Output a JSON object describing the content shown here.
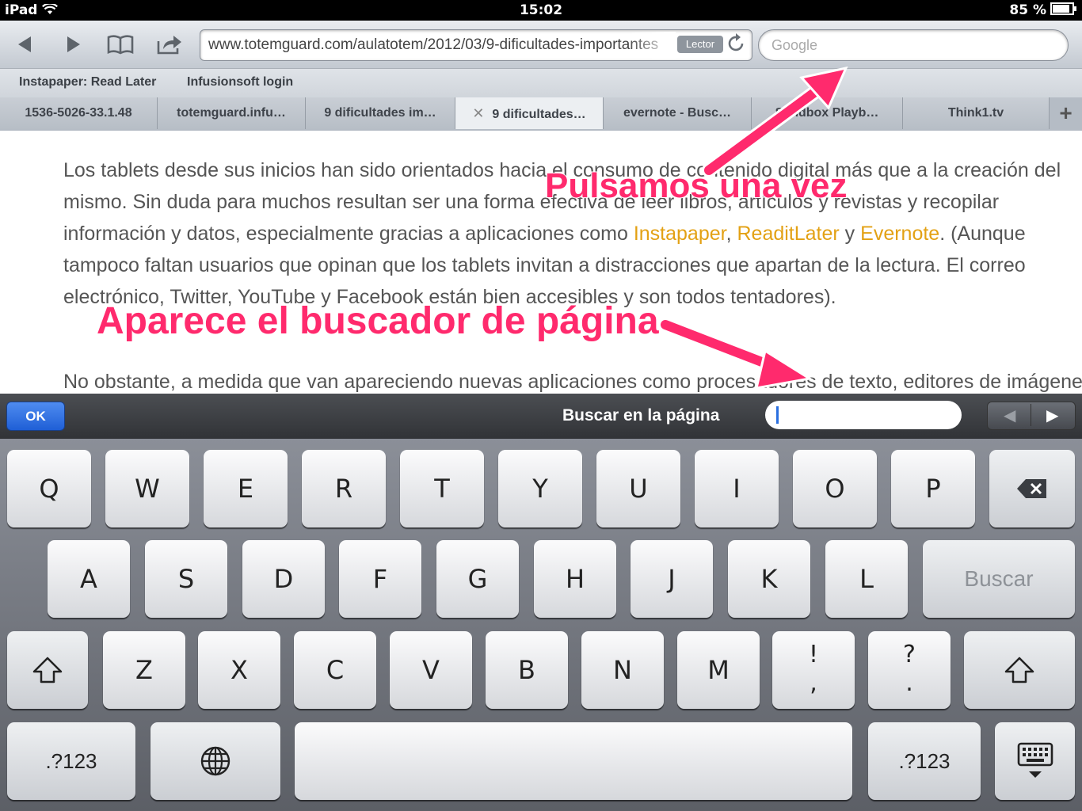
{
  "status_bar": {
    "device": "iPad",
    "time": "15:02",
    "battery": "85 %"
  },
  "toolbar": {
    "url": "www.totemguard.com/aulatotem/2012/03/9-dificultades-importantes",
    "reader_label": "Lector",
    "search_placeholder": "Google"
  },
  "bookmarks": [
    "Instapaper: Read Later",
    "Infusionsoft login"
  ],
  "tabs": [
    "1536-5026-33.1.48",
    "totemguard.infu…",
    "9 dificultades im…",
    "9 dificultades…",
    "evernote - Busc…",
    "Sandbox Playb…",
    "Think1.tv"
  ],
  "content": {
    "para1_a": "Los tablets desde sus inicios han sido orientados hacia el consumo de contenido digital más que a la creación del mismo. Sin duda para muchos resultan ser una forma efectiva de leer libros, artículos y revistas y recopilar información y datos, especialmente gracias a aplicaciones como ",
    "link_instapaper": "Instapaper",
    "sep1": ", ",
    "link_readitlater": "ReaditLater",
    "sep2": " y ",
    "link_evernote": "Evernote",
    "para1_b": ". (Aunque tampoco faltan usuarios que opinan que los tablets invitan a distracciones que apartan de la lectura. El correo electrónico, Twitter, YouTube y Facebook están bien accesibles y son todos tentadores).",
    "para2": "No obstante, a medida que van apareciendo nuevas aplicaciones como procesadores de texto, editores de imágenes y video, creadores de mapas mentales, aplicaciones para crear y editar presentaciones, están cambiando mucho de lo que el tablet puede ayudarte a conseguir."
  },
  "annotations": {
    "top": "Pulsamos una vez",
    "middle": "Aparece el buscador de página"
  },
  "findbar": {
    "ok_label": "OK",
    "label": "Buscar en la página",
    "prev": "◀",
    "next": "▶"
  },
  "keyboard": {
    "row1": [
      "Q",
      "W",
      "E",
      "R",
      "T",
      "Y",
      "U",
      "I",
      "O",
      "P"
    ],
    "row2": [
      "A",
      "S",
      "D",
      "F",
      "G",
      "H",
      "J",
      "K",
      "L"
    ],
    "row3": [
      "Z",
      "X",
      "C",
      "V",
      "B",
      "N",
      "M"
    ],
    "excl_top": "!",
    "excl_bottom": ",",
    "quest_top": "?",
    "quest_bottom": ".",
    "search_key": "Buscar",
    "numbers_key": ".?123",
    "accent_color": "#ff2a6d"
  }
}
